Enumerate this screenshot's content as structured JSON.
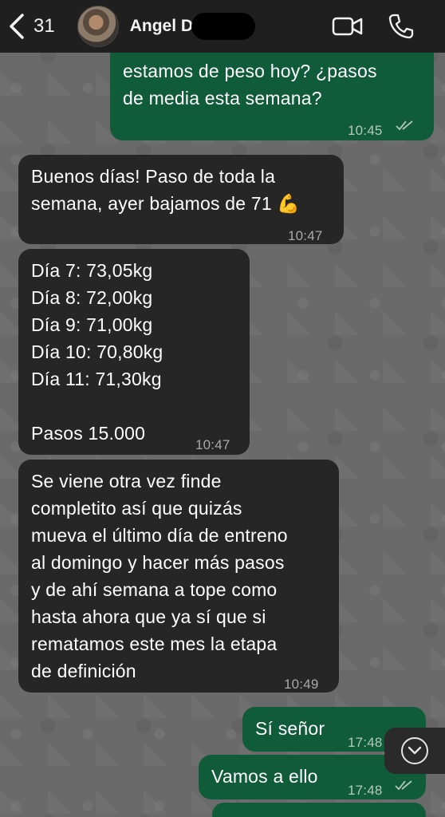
{
  "header": {
    "back_count": "31",
    "contact_name": "Angel D"
  },
  "messages": [
    {
      "dir": "out",
      "lines": [
        "estamos de peso hoy? ¿pasos",
        "de media esta semana?"
      ],
      "time": "10:45",
      "read": true
    },
    {
      "dir": "in",
      "lines": [
        "Buenos días! Paso de toda la",
        "semana, ayer bajamos de 71 💪"
      ],
      "time": "10:47"
    },
    {
      "dir": "in",
      "lines": [
        "Día 7: 73,05kg",
        "Día 8: 72,00kg",
        "Día 9: 71,00kg",
        "Día 10: 70,80kg",
        "Día 11: 71,30kg",
        "",
        "Pasos 15.000"
      ],
      "time": "10:47"
    },
    {
      "dir": "in",
      "lines": [
        "Se viene otra vez finde",
        "completito así que quizás",
        "mueva el último día de entreno",
        "al domingo y hacer más pasos",
        "y de ahí semana a tope como",
        "hasta ahora que ya sí que si",
        "rematamos este mes la etapa",
        "de definición"
      ],
      "time": "10:49"
    },
    {
      "dir": "out",
      "lines": [
        "Sí señor"
      ],
      "time": "17:48",
      "read": true
    },
    {
      "dir": "out",
      "lines": [
        "Vamos a ello"
      ],
      "time": "17:48",
      "read": true
    }
  ],
  "icons": {
    "back": "chevron-left-icon",
    "video": "video-camera-icon",
    "call": "phone-icon",
    "scroll": "chevron-down-icon",
    "read": "double-check-icon"
  },
  "colors": {
    "header_bg": "#1f1f1f",
    "incoming_bubble": "#262626",
    "outgoing_bubble": "#0f5b3a",
    "wallpaper": "#6a6a6a"
  }
}
